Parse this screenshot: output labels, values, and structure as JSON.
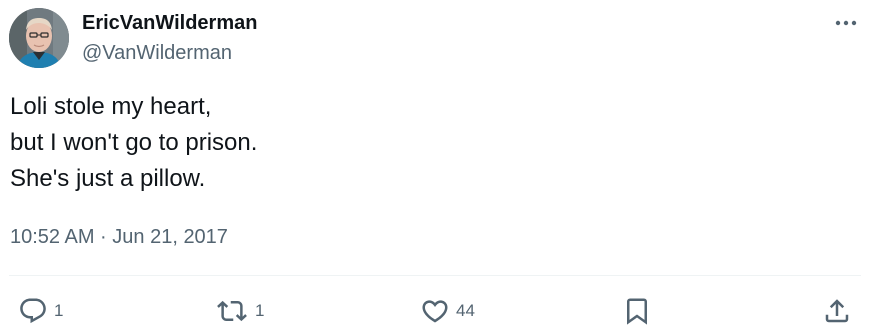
{
  "author": {
    "display_name": "EricVanWilderman",
    "handle": "@VanWilderman"
  },
  "tweet": {
    "lines": [
      "Loli stole my heart,",
      "but I won't go to prison.",
      "She's just a pillow."
    ],
    "timestamp": "10:52 AM · Jun 21, 2017"
  },
  "actions": {
    "reply_count": "1",
    "retweet_count": "1",
    "like_count": "44"
  },
  "icons": {
    "more": "more-icon",
    "reply": "reply-icon",
    "retweet": "retweet-icon",
    "like": "heart-icon",
    "bookmark": "bookmark-icon",
    "share": "share-icon"
  },
  "colors": {
    "text": "#0f1419",
    "secondary": "#536471",
    "divider": "#eff3f4"
  }
}
